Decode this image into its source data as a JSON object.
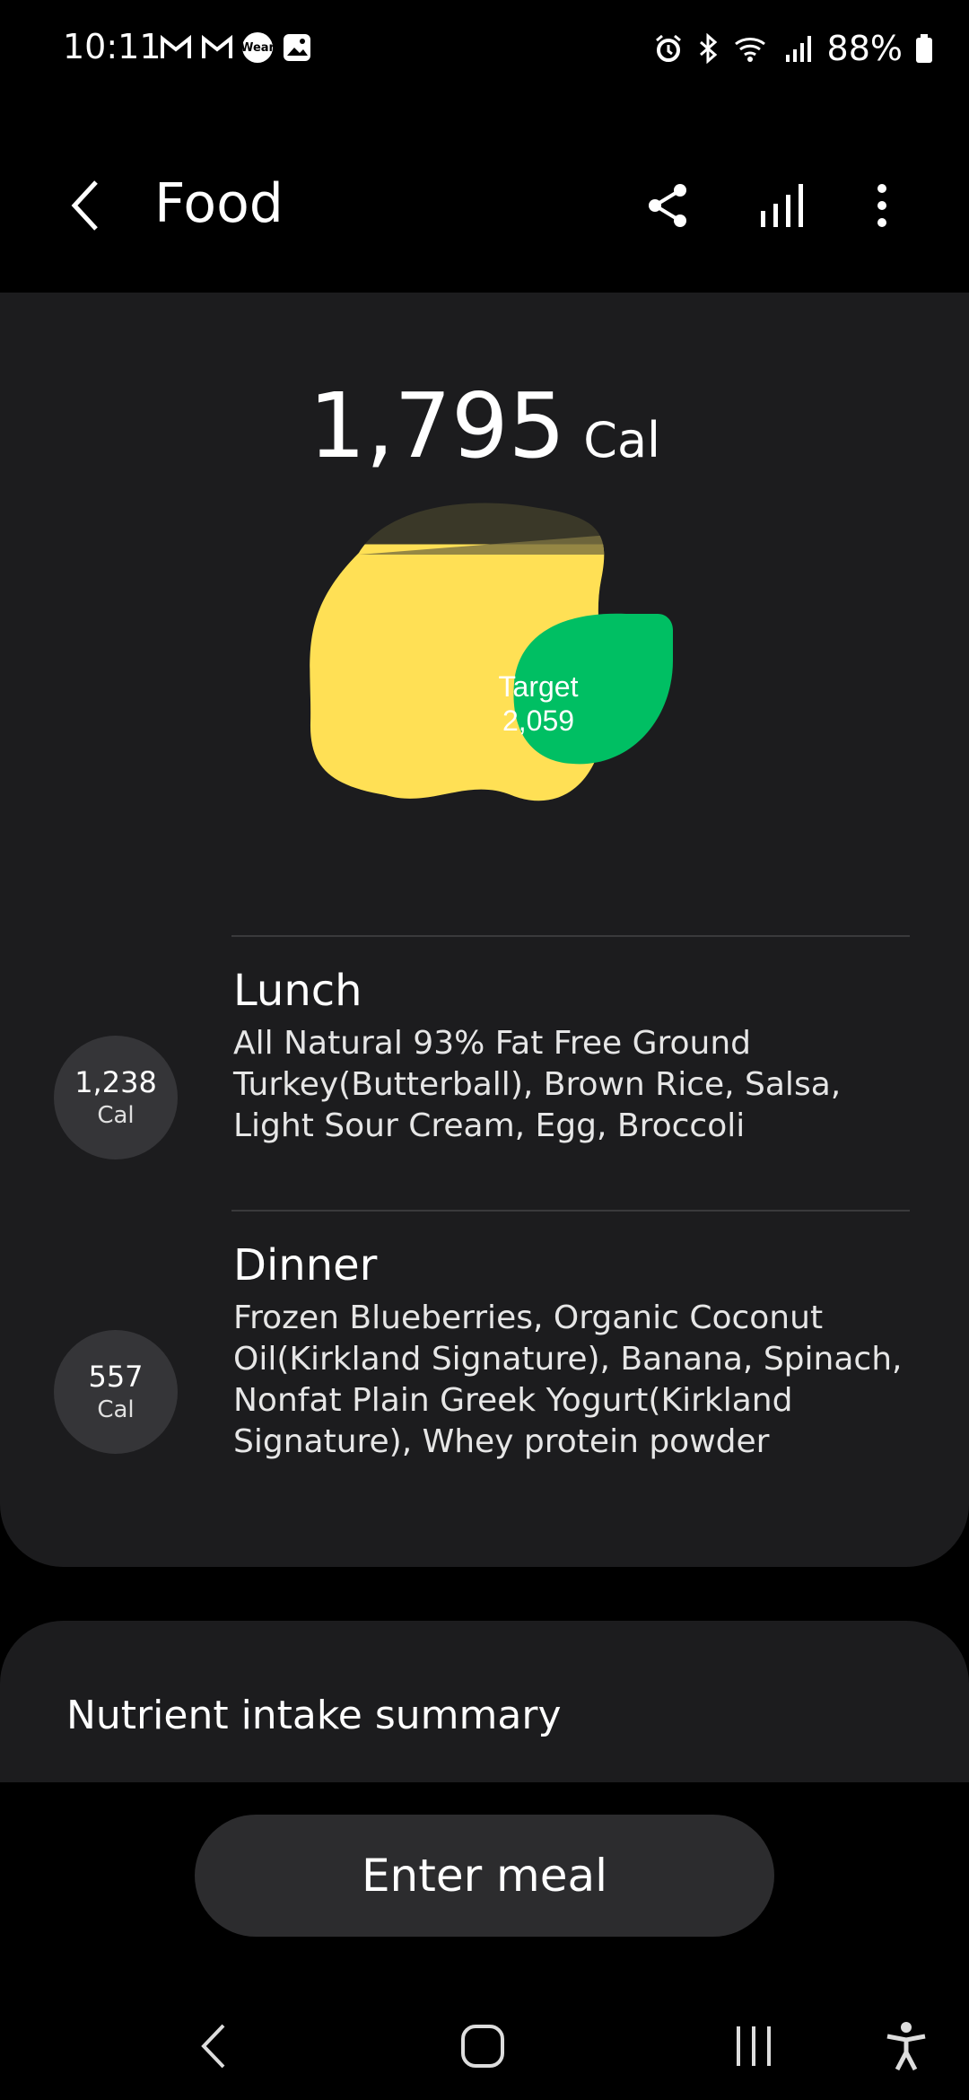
{
  "status_bar": {
    "time": "10:11",
    "left_icons": [
      "gmail-icon",
      "gmail-icon",
      "wear-icon",
      "gallery-icon"
    ],
    "wear_label": "Wear",
    "right_icons": [
      "alarm-icon",
      "bluetooth-icon",
      "wifi-icon",
      "signal-icon",
      "battery-icon"
    ],
    "battery": "88%"
  },
  "header": {
    "title": "Food",
    "actions": [
      "share-icon",
      "chart-icon",
      "more-icon"
    ]
  },
  "summary": {
    "total_value": "1,795",
    "total_unit": "Cal",
    "target_line1": "Target",
    "target_line2": "2,059",
    "consumed_fraction": 0.872,
    "colors": {
      "consumed": "#ffe055",
      "target": "#00bf63"
    }
  },
  "meals": [
    {
      "name": "Lunch",
      "calories": "1,238",
      "unit": "Cal",
      "items": "All Natural 93% Fat Free Ground Turkey(Butterball), Brown Rice, Salsa, Light Sour Cream, Egg, Broccoli"
    },
    {
      "name": "Dinner",
      "calories": "557",
      "unit": "Cal",
      "items": "Frozen Blueberries, Organic Coconut Oil(Kirkland Signature), Banana, Spinach, Nonfat Plain Greek Yogurt(Kirkland Signature), Whey protein powder"
    }
  ],
  "nutrient_section": {
    "title": "Nutrient intake summary"
  },
  "enter_meal_label": "Enter meal",
  "nav": [
    "back-nav-icon",
    "home-nav-icon",
    "recents-nav-icon",
    "accessibility-icon"
  ]
}
